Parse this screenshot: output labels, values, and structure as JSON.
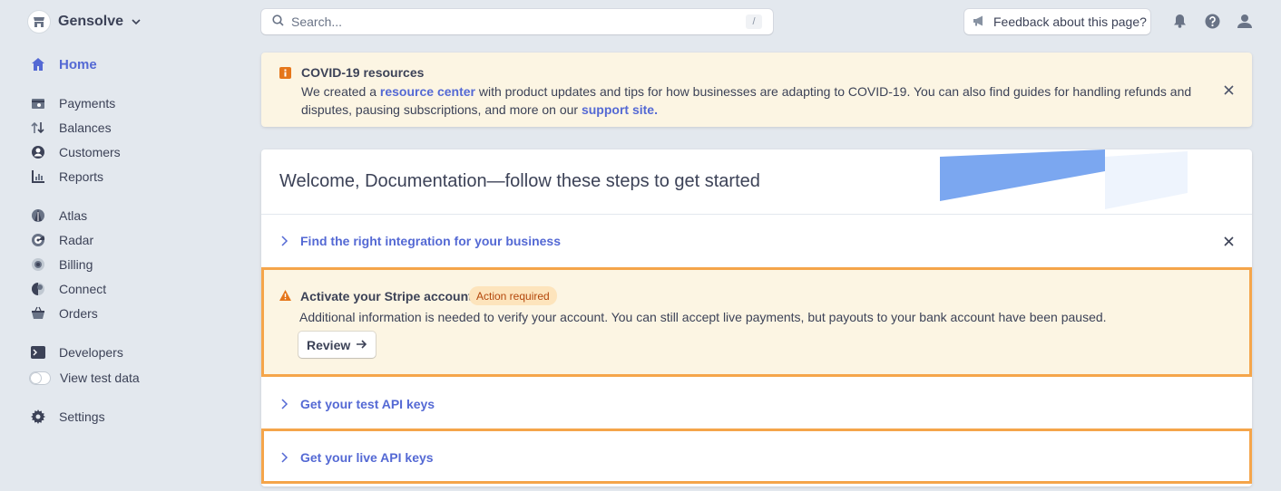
{
  "account": {
    "name": "Gensolve"
  },
  "sidebar": {
    "home": "Home",
    "group1": [
      "Payments",
      "Balances",
      "Customers",
      "Reports"
    ],
    "group2": [
      "Atlas",
      "Radar",
      "Billing",
      "Connect",
      "Orders"
    ],
    "developers": "Developers",
    "test_data": "View test data",
    "settings": "Settings"
  },
  "search": {
    "placeholder": "Search...",
    "shortcut": "/"
  },
  "feedback": {
    "label": "Feedback about this page?"
  },
  "covid": {
    "title": "COVID-19 resources",
    "text1": "We created a ",
    "link1": "resource center",
    "text2": " with product updates and tips for how businesses are adapting to COVID-19. You can also find guides for handling refunds and disputes, pausing subscriptions, and more on our ",
    "link2": "support site",
    "text3": "."
  },
  "welcome": {
    "title": "Welcome, Documentation—follow these steps to get started",
    "step1": "Find the right integration for your business",
    "activate_title": "Activate your Stripe account",
    "activate_badge": "Action required",
    "activate_body": "Additional information is needed to verify your account. You can still accept live payments, but payouts to your bank account have been paused.",
    "review": "Review",
    "step3": "Get your test API keys",
    "step4": "Get your live API keys"
  },
  "colors": {
    "accent": "#5469d4",
    "warning_border": "#f5a54a",
    "banner_bg": "#fcf5e3"
  }
}
